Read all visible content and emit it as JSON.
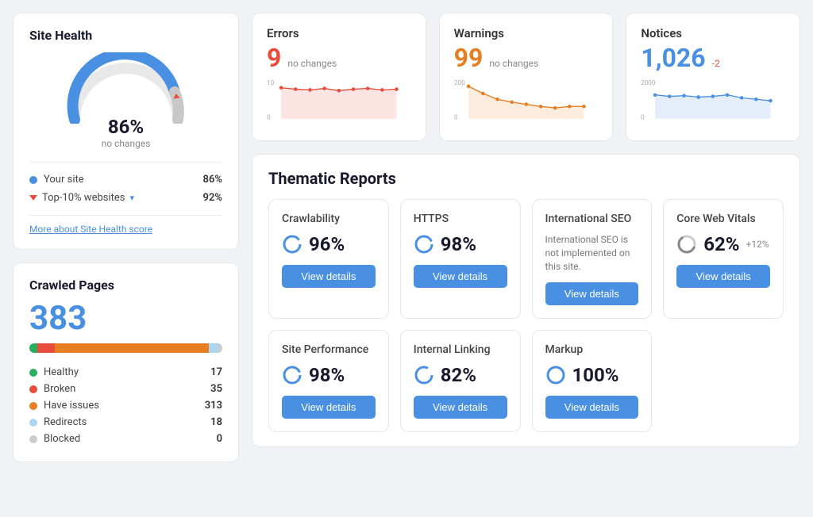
{
  "site_health": {
    "title": "Site Health",
    "percent": "86%",
    "sub": "no changes",
    "your_site_label": "Your site",
    "your_site_val": "86%",
    "top10_label": "Top-10% websites",
    "top10_val": "92%",
    "more_link": "More about Site Health score"
  },
  "crawled_pages": {
    "title": "Crawled Pages",
    "total": "383",
    "legend": [
      {
        "label": "Healthy",
        "count": "17",
        "color_class": "dot-green"
      },
      {
        "label": "Broken",
        "count": "35",
        "color_class": "dot-darkred"
      },
      {
        "label": "Have issues",
        "count": "313",
        "color_class": "dot-orange"
      },
      {
        "label": "Redirects",
        "count": "18",
        "color_class": "dot-lightblue"
      },
      {
        "label": "Blocked",
        "count": "0",
        "color_class": "dot-lightgray"
      }
    ]
  },
  "metrics": [
    {
      "label": "Errors",
      "value": "9",
      "value_color": "metric-num-red",
      "change": "no changes",
      "change_type": "neutral",
      "y_top": "10",
      "y_bot": "0",
      "chart_color": "red"
    },
    {
      "label": "Warnings",
      "value": "99",
      "value_color": "metric-num-orange",
      "change": "no changes",
      "change_type": "neutral",
      "y_top": "200",
      "y_bot": "0",
      "chart_color": "orange"
    },
    {
      "label": "Notices",
      "value": "1,026",
      "value_color": "metric-num-blue",
      "change": "-2",
      "change_type": "negative",
      "y_top": "2000",
      "y_bot": "0",
      "chart_color": "blue"
    }
  ],
  "thematic_reports": {
    "title": "Thematic Reports",
    "reports": [
      {
        "name": "Crawlability",
        "score": "96%",
        "delta": "",
        "desc": "",
        "btn": "View details",
        "row": 0
      },
      {
        "name": "HTTPS",
        "score": "98%",
        "delta": "",
        "desc": "",
        "btn": "View details",
        "row": 0
      },
      {
        "name": "International SEO",
        "score": "",
        "delta": "",
        "desc": "International SEO is not implemented on this site.",
        "btn": "View details",
        "row": 0
      },
      {
        "name": "Core Web Vitals",
        "score": "62%",
        "delta": "+12%",
        "desc": "",
        "btn": "View details",
        "row": 0
      },
      {
        "name": "Site Performance",
        "score": "98%",
        "delta": "",
        "desc": "",
        "btn": "View details",
        "row": 1
      },
      {
        "name": "Internal Linking",
        "score": "82%",
        "delta": "",
        "desc": "",
        "btn": "View details",
        "row": 1
      },
      {
        "name": "Markup",
        "score": "100%",
        "delta": "",
        "desc": "",
        "btn": "View details",
        "row": 1
      }
    ]
  }
}
